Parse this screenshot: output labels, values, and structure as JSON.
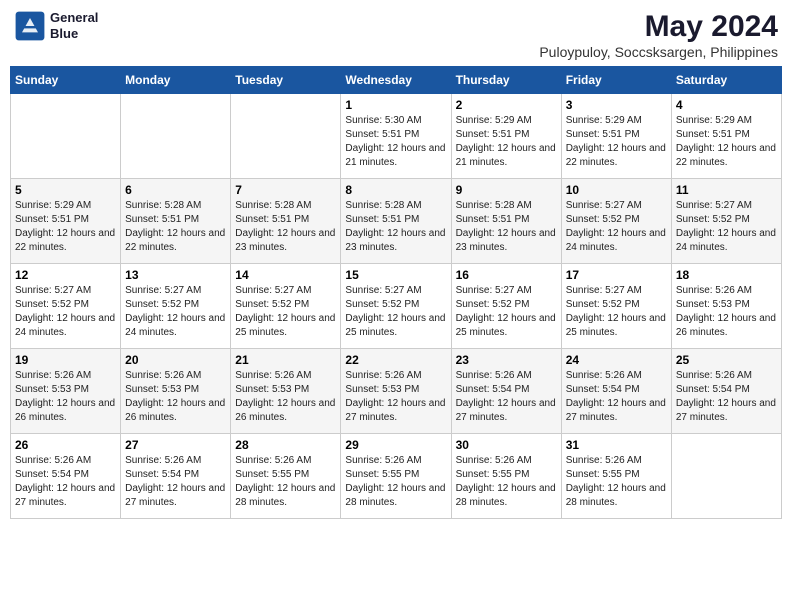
{
  "header": {
    "logo_line1": "General",
    "logo_line2": "Blue",
    "main_title": "May 2024",
    "subtitle": "Puloypuloy, Soccsksargen, Philippines"
  },
  "weekdays": [
    "Sunday",
    "Monday",
    "Tuesday",
    "Wednesday",
    "Thursday",
    "Friday",
    "Saturday"
  ],
  "weeks": [
    [
      {
        "day": "",
        "sunrise": "",
        "sunset": "",
        "daylight": ""
      },
      {
        "day": "",
        "sunrise": "",
        "sunset": "",
        "daylight": ""
      },
      {
        "day": "",
        "sunrise": "",
        "sunset": "",
        "daylight": ""
      },
      {
        "day": "1",
        "sunrise": "Sunrise: 5:30 AM",
        "sunset": "Sunset: 5:51 PM",
        "daylight": "Daylight: 12 hours and 21 minutes."
      },
      {
        "day": "2",
        "sunrise": "Sunrise: 5:29 AM",
        "sunset": "Sunset: 5:51 PM",
        "daylight": "Daylight: 12 hours and 21 minutes."
      },
      {
        "day": "3",
        "sunrise": "Sunrise: 5:29 AM",
        "sunset": "Sunset: 5:51 PM",
        "daylight": "Daylight: 12 hours and 22 minutes."
      },
      {
        "day": "4",
        "sunrise": "Sunrise: 5:29 AM",
        "sunset": "Sunset: 5:51 PM",
        "daylight": "Daylight: 12 hours and 22 minutes."
      }
    ],
    [
      {
        "day": "5",
        "sunrise": "Sunrise: 5:29 AM",
        "sunset": "Sunset: 5:51 PM",
        "daylight": "Daylight: 12 hours and 22 minutes."
      },
      {
        "day": "6",
        "sunrise": "Sunrise: 5:28 AM",
        "sunset": "Sunset: 5:51 PM",
        "daylight": "Daylight: 12 hours and 22 minutes."
      },
      {
        "day": "7",
        "sunrise": "Sunrise: 5:28 AM",
        "sunset": "Sunset: 5:51 PM",
        "daylight": "Daylight: 12 hours and 23 minutes."
      },
      {
        "day": "8",
        "sunrise": "Sunrise: 5:28 AM",
        "sunset": "Sunset: 5:51 PM",
        "daylight": "Daylight: 12 hours and 23 minutes."
      },
      {
        "day": "9",
        "sunrise": "Sunrise: 5:28 AM",
        "sunset": "Sunset: 5:51 PM",
        "daylight": "Daylight: 12 hours and 23 minutes."
      },
      {
        "day": "10",
        "sunrise": "Sunrise: 5:27 AM",
        "sunset": "Sunset: 5:52 PM",
        "daylight": "Daylight: 12 hours and 24 minutes."
      },
      {
        "day": "11",
        "sunrise": "Sunrise: 5:27 AM",
        "sunset": "Sunset: 5:52 PM",
        "daylight": "Daylight: 12 hours and 24 minutes."
      }
    ],
    [
      {
        "day": "12",
        "sunrise": "Sunrise: 5:27 AM",
        "sunset": "Sunset: 5:52 PM",
        "daylight": "Daylight: 12 hours and 24 minutes."
      },
      {
        "day": "13",
        "sunrise": "Sunrise: 5:27 AM",
        "sunset": "Sunset: 5:52 PM",
        "daylight": "Daylight: 12 hours and 24 minutes."
      },
      {
        "day": "14",
        "sunrise": "Sunrise: 5:27 AM",
        "sunset": "Sunset: 5:52 PM",
        "daylight": "Daylight: 12 hours and 25 minutes."
      },
      {
        "day": "15",
        "sunrise": "Sunrise: 5:27 AM",
        "sunset": "Sunset: 5:52 PM",
        "daylight": "Daylight: 12 hours and 25 minutes."
      },
      {
        "day": "16",
        "sunrise": "Sunrise: 5:27 AM",
        "sunset": "Sunset: 5:52 PM",
        "daylight": "Daylight: 12 hours and 25 minutes."
      },
      {
        "day": "17",
        "sunrise": "Sunrise: 5:27 AM",
        "sunset": "Sunset: 5:52 PM",
        "daylight": "Daylight: 12 hours and 25 minutes."
      },
      {
        "day": "18",
        "sunrise": "Sunrise: 5:26 AM",
        "sunset": "Sunset: 5:53 PM",
        "daylight": "Daylight: 12 hours and 26 minutes."
      }
    ],
    [
      {
        "day": "19",
        "sunrise": "Sunrise: 5:26 AM",
        "sunset": "Sunset: 5:53 PM",
        "daylight": "Daylight: 12 hours and 26 minutes."
      },
      {
        "day": "20",
        "sunrise": "Sunrise: 5:26 AM",
        "sunset": "Sunset: 5:53 PM",
        "daylight": "Daylight: 12 hours and 26 minutes."
      },
      {
        "day": "21",
        "sunrise": "Sunrise: 5:26 AM",
        "sunset": "Sunset: 5:53 PM",
        "daylight": "Daylight: 12 hours and 26 minutes."
      },
      {
        "day": "22",
        "sunrise": "Sunrise: 5:26 AM",
        "sunset": "Sunset: 5:53 PM",
        "daylight": "Daylight: 12 hours and 27 minutes."
      },
      {
        "day": "23",
        "sunrise": "Sunrise: 5:26 AM",
        "sunset": "Sunset: 5:54 PM",
        "daylight": "Daylight: 12 hours and 27 minutes."
      },
      {
        "day": "24",
        "sunrise": "Sunrise: 5:26 AM",
        "sunset": "Sunset: 5:54 PM",
        "daylight": "Daylight: 12 hours and 27 minutes."
      },
      {
        "day": "25",
        "sunrise": "Sunrise: 5:26 AM",
        "sunset": "Sunset: 5:54 PM",
        "daylight": "Daylight: 12 hours and 27 minutes."
      }
    ],
    [
      {
        "day": "26",
        "sunrise": "Sunrise: 5:26 AM",
        "sunset": "Sunset: 5:54 PM",
        "daylight": "Daylight: 12 hours and 27 minutes."
      },
      {
        "day": "27",
        "sunrise": "Sunrise: 5:26 AM",
        "sunset": "Sunset: 5:54 PM",
        "daylight": "Daylight: 12 hours and 27 minutes."
      },
      {
        "day": "28",
        "sunrise": "Sunrise: 5:26 AM",
        "sunset": "Sunset: 5:55 PM",
        "daylight": "Daylight: 12 hours and 28 minutes."
      },
      {
        "day": "29",
        "sunrise": "Sunrise: 5:26 AM",
        "sunset": "Sunset: 5:55 PM",
        "daylight": "Daylight: 12 hours and 28 minutes."
      },
      {
        "day": "30",
        "sunrise": "Sunrise: 5:26 AM",
        "sunset": "Sunset: 5:55 PM",
        "daylight": "Daylight: 12 hours and 28 minutes."
      },
      {
        "day": "31",
        "sunrise": "Sunrise: 5:26 AM",
        "sunset": "Sunset: 5:55 PM",
        "daylight": "Daylight: 12 hours and 28 minutes."
      },
      {
        "day": "",
        "sunrise": "",
        "sunset": "",
        "daylight": ""
      }
    ]
  ]
}
